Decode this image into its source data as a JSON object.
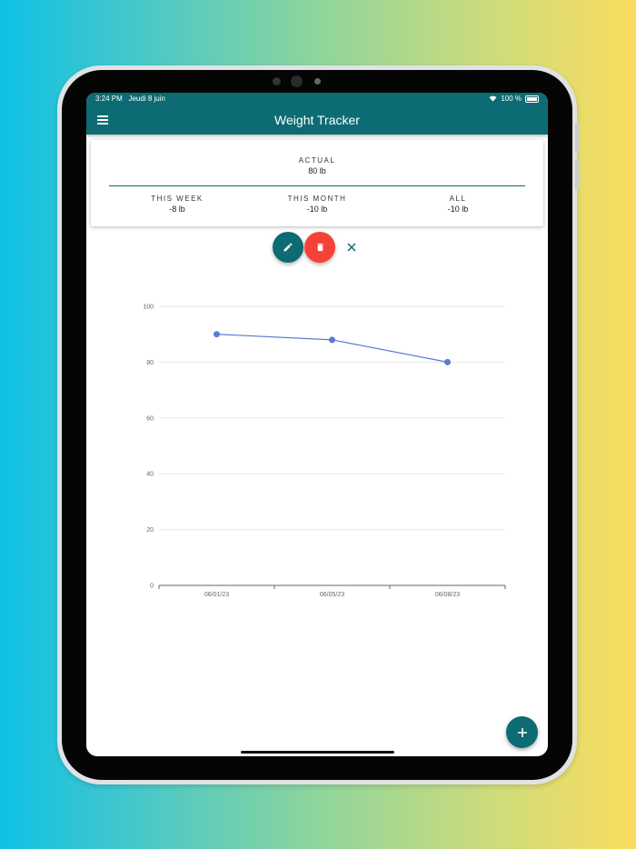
{
  "status_bar": {
    "time": "3:24 PM",
    "date": "Jeudi 8 juin",
    "battery": "100 %"
  },
  "app_bar": {
    "title": "Weight Tracker",
    "menu_icon": "hamburger-menu-icon"
  },
  "stats": {
    "actual": {
      "label": "ACTUAL",
      "value": "80 lb"
    },
    "this_week": {
      "label": "THIS WEEK",
      "value": "-8 lb"
    },
    "this_month": {
      "label": "THIS MONTH",
      "value": "-10 lb"
    },
    "all": {
      "label": "ALL",
      "value": "-10 lb"
    }
  },
  "actions": {
    "edit_icon": "pencil-icon",
    "delete_icon": "trash-icon",
    "close_icon": "close-icon",
    "add_icon": "plus-icon"
  },
  "colors": {
    "primary": "#0d6b73",
    "delete": "#f44336",
    "series": "#5b7bd5"
  },
  "chart_data": {
    "type": "line",
    "categories": [
      "06/01/23",
      "06/05/23",
      "06/08/23"
    ],
    "values": [
      90,
      88,
      80
    ],
    "ylim": [
      0,
      100
    ],
    "yticks": [
      0,
      20,
      40,
      60,
      80,
      100
    ],
    "grid": true
  }
}
